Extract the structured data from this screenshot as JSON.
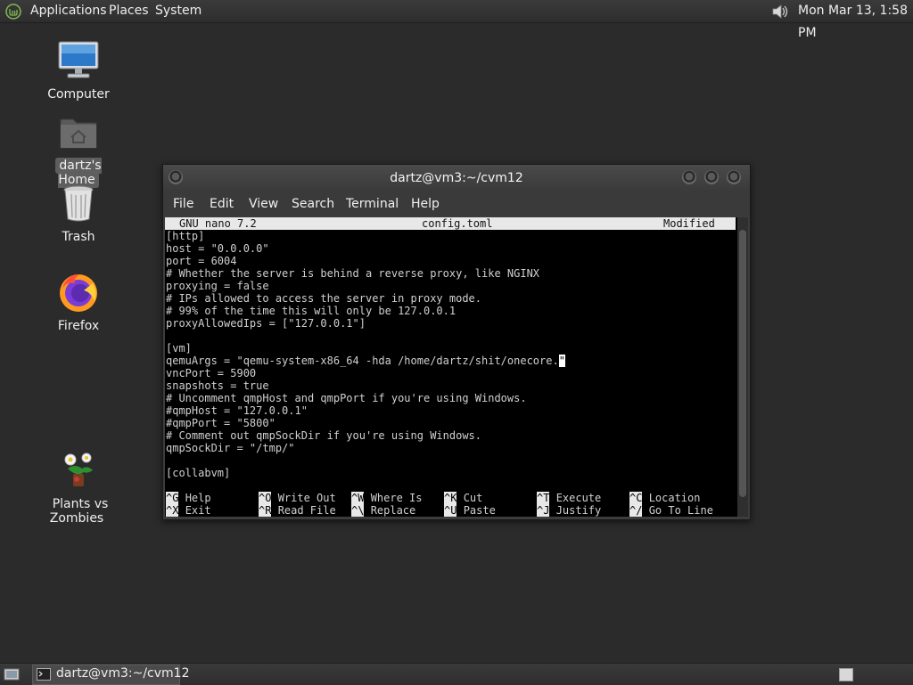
{
  "top_panel": {
    "menus": [
      "Applications",
      "Places",
      "System"
    ],
    "clock": "Mon Mar 13,  1:58 PM"
  },
  "desktop": {
    "icons": [
      {
        "label": "Computer",
        "icon": "computer-icon"
      },
      {
        "label": "dartz's Home",
        "icon": "home-folder-icon"
      },
      {
        "label": "Trash",
        "icon": "trash-icon"
      },
      {
        "label": "Firefox",
        "icon": "firefox-icon"
      },
      {
        "label": "Plants vs Zombies",
        "icon": "plants-vs-zombies-icon"
      }
    ]
  },
  "terminal_window": {
    "title": "dartz@vm3:~/cvm12",
    "menu": [
      "File",
      "Edit",
      "View",
      "Search",
      "Terminal",
      "Help"
    ],
    "nano": {
      "version": "GNU nano 7.2",
      "filename": "config.toml",
      "status": "Modified",
      "lines": [
        "[http]",
        "host = \"0.0.0.0\"",
        "port = 6004",
        "# Whether the server is behind a reverse proxy, like NGINX",
        "proxying = false",
        "# IPs allowed to access the server in proxy mode.",
        "# 99% of the time this will only be 127.0.0.1",
        "proxyAllowedIps = [\"127.0.0.1\"]",
        "",
        "[vm]",
        "qemuArgs = \"qemu-system-x86_64 -hda /home/dartz/shit/onecore.",
        "vncPort = 5900",
        "snapshots = true",
        "# Uncomment qmpHost and qmpPort if you're using Windows.",
        "#qmpHost = \"127.0.0.1\"",
        "#qmpPort = \"5800\"",
        "# Comment out qmpSockDir if you're using Windows.",
        "qmpSockDir = \"/tmp/\"",
        "",
        "[collabvm]"
      ],
      "cursor_char": "\"",
      "shortcuts_row1": [
        {
          "key": "^G",
          "label": "Help"
        },
        {
          "key": "^O",
          "label": "Write Out"
        },
        {
          "key": "^W",
          "label": "Where Is"
        },
        {
          "key": "^K",
          "label": "Cut"
        },
        {
          "key": "^T",
          "label": "Execute"
        },
        {
          "key": "^C",
          "label": "Location"
        }
      ],
      "shortcuts_row2": [
        {
          "key": "^X",
          "label": "Exit"
        },
        {
          "key": "^R",
          "label": "Read File"
        },
        {
          "key": "^\\",
          "label": "Replace"
        },
        {
          "key": "^U",
          "label": "Paste"
        },
        {
          "key": "^J",
          "label": "Justify"
        },
        {
          "key": "^/",
          "label": "Go To Line"
        }
      ]
    }
  },
  "bottom_panel": {
    "task": "dartz@vm3:~/cvm12"
  }
}
